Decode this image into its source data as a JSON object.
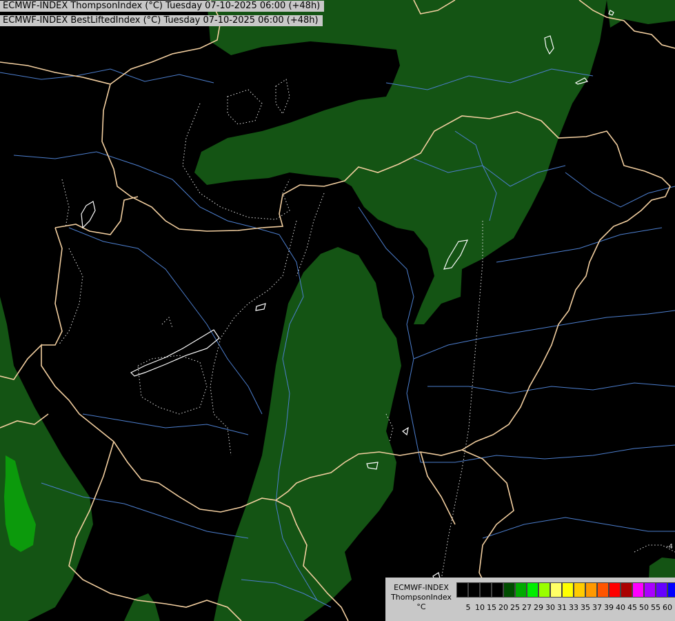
{
  "header": {
    "line1": "ECMWF-INDEX ThompsonIndex (°C) Tuesday 07-10-2025 06:00 (+48h)",
    "line2": "ECMWF-INDEX BestLiftedIndex (°C) Tuesday 07-10-2025 06:00 (+48h)"
  },
  "legend": {
    "title_line1": "ECMWF-INDEX",
    "title_line2": "ThompsonIndex",
    "unit": "°C",
    "ticks": [
      "5",
      "10",
      "15",
      "20",
      "25",
      "27",
      "29",
      "30",
      "31",
      "33",
      "35",
      "37",
      "39",
      "40",
      "45",
      "50",
      "55",
      "60"
    ],
    "colors": [
      "#000000",
      "#000000",
      "#000000",
      "#000000",
      "#004d00",
      "#00aa00",
      "#00ee00",
      "#99ff00",
      "#ffff66",
      "#ffff00",
      "#ffcc00",
      "#ff9900",
      "#ff5500",
      "#ff0000",
      "#aa0000",
      "#ff00ff",
      "#aa00ff",
      "#6600ff",
      "#0000ff"
    ]
  },
  "map": {
    "fill_colors": {
      "green_dark": "#145414",
      "green_mid": "#1f6b1f",
      "green_bright": "#0c9a0c"
    },
    "border_color": "#f3cfa0",
    "river_color": "#4d7fcf",
    "contour_label": "-4"
  }
}
